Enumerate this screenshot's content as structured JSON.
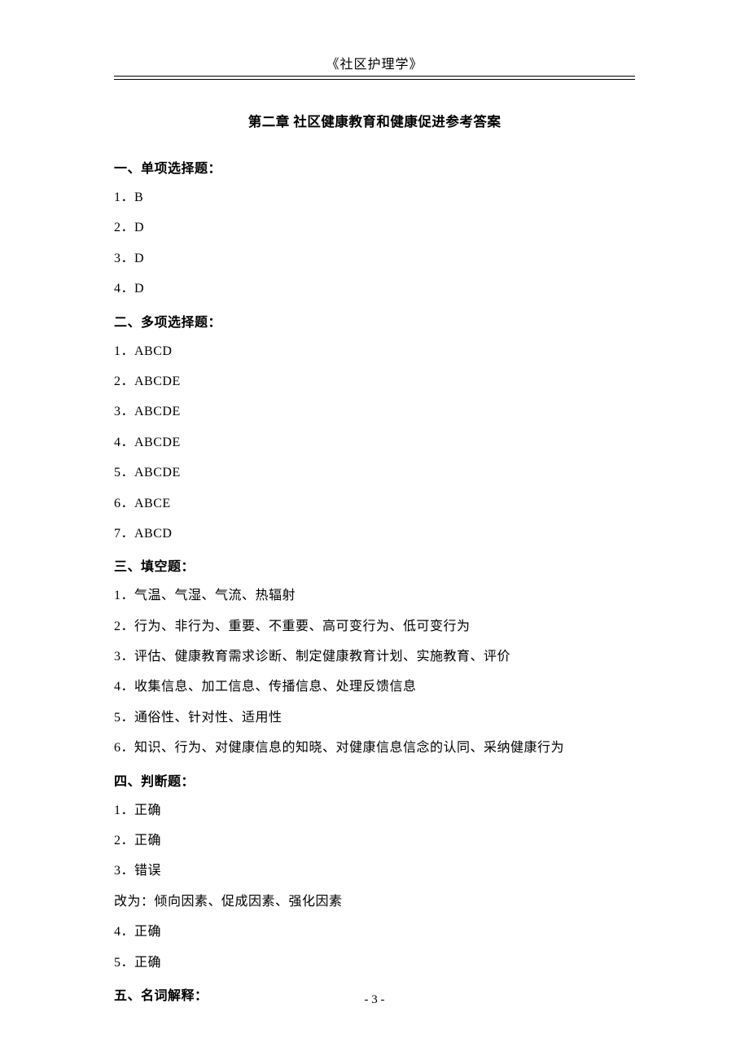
{
  "header": "《社区护理学》",
  "title": "第二章 社区健康教育和健康促进参考答案",
  "sections": {
    "s1": {
      "header": "一、单项选择题：",
      "items": [
        "1．B",
        "2．D",
        "3．D",
        "4．D"
      ]
    },
    "s2": {
      "header": "二、多项选择题：",
      "items": [
        "1．ABCD",
        "2．ABCDE",
        "3．ABCDE",
        "4．ABCDE",
        "5．ABCDE",
        "6．ABCE",
        "7．ABCD"
      ]
    },
    "s3": {
      "header": "三、填空题：",
      "items": [
        "1．气温、气湿、气流、热辐射",
        "2．行为、非行为、重要、不重要、高可变行为、低可变行为",
        "3．评估、健康教育需求诊断、制定健康教育计划、实施教育、评价",
        "4．收集信息、加工信息、传播信息、处理反馈信息",
        "5．通俗性、针对性、适用性",
        "6．知识、行为、对健康信息的知晓、对健康信息信念的认同、采纳健康行为"
      ]
    },
    "s4": {
      "header": "四、判断题：",
      "items": [
        "1．正确",
        "2．正确",
        "3．错误",
        "改为：倾向因素、促成因素、强化因素",
        "4．正确",
        "5．正确"
      ]
    },
    "s5": {
      "header": "五、名词解释："
    }
  },
  "pageNumber": "- 3 -"
}
